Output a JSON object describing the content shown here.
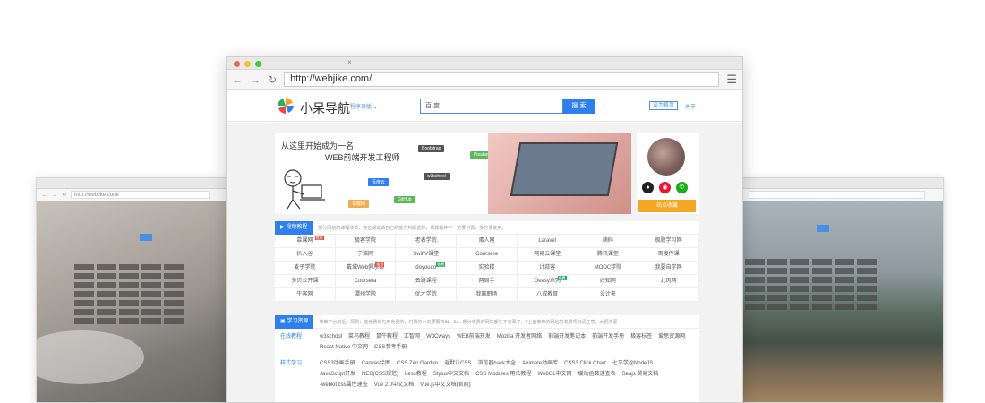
{
  "side_left": {
    "url": "http://webjike.com/"
  },
  "main": {
    "url": "http://webjike.com/",
    "brand": "小呆导航",
    "brand_sub": "程序员版 ⌄",
    "search_engine": "百 度",
    "search_button": "搜 索",
    "set_home": "设为首页",
    "about": "关于",
    "banner": {
      "line1": "从这里开始成为一名",
      "line2": "WEB前端开发工程师",
      "tags": [
        {
          "label": "Bootstrap",
          "color": "#555555"
        },
        {
          "label": "Pixabay",
          "color": "#5cb85c"
        },
        {
          "label": "w3school",
          "color": "#555555"
        },
        {
          "label": "百度云",
          "color": "#2f80ed"
        },
        {
          "label": "GitHub",
          "color": "#5cb85c"
        },
        {
          "label": "花瓣网",
          "color": "#f0ad4e"
        }
      ]
    },
    "follow_button": "站点收藏",
    "video_section": {
      "title": "视频教程",
      "desc": "部分网站的课程收费，各位朋友请自己的能力判断选择，看教程并不一定要付费，多方便使用。"
    },
    "video_rows": [
      [
        "慕课网",
        "极客学院",
        "老表学院",
        "蛋人网",
        "Laravel",
        "萌码",
        "极题学习网"
      ],
      [
        "扒入谷",
        "宁骆网",
        "SwiftV课堂",
        "Coursera",
        "网易云课堂",
        "腾讯课堂",
        "百度传课"
      ],
      [
        "麦子学院",
        "戴城Web俱乐部",
        "doyoudo",
        "实验楼",
        "计蒜客",
        "MOOC学院",
        "我要自学网"
      ],
      [
        "多贝公开课",
        "Coursera",
        "云路课程",
        "两周手",
        "Oeasy系列",
        "好知网",
        "北风网"
      ],
      [
        "牛客网",
        "潭州学院",
        "优才学院",
        "我赢职场",
        "八戒教育",
        "设计夹",
        ""
      ]
    ],
    "video_badges": [
      {
        "row": 0,
        "col": 0,
        "label": "推荐",
        "color": "#e74c3c"
      },
      {
        "row": 2,
        "col": 1,
        "label": "推荐",
        "color": "#e74c3c"
      },
      {
        "row": 2,
        "col": 2,
        "label": "免费",
        "color": "#27ae60"
      },
      {
        "row": 3,
        "col": 4,
        "label": "免费",
        "color": "#27ae60"
      }
    ],
    "learn_section": {
      "title": "学习资源",
      "desc": "推荐不分前后，原则：能免费就先用免费的，付费的一定要再掏出。So...部分收费的网站都先不收录了。//上面推荐的网站的收费项目请注意，大把资源"
    },
    "learn_rows": [
      {
        "label": "在线教程",
        "links": [
          "w3school",
          "菜鸟教程",
          "鼠牛教程",
          "汇智网",
          "W3Cways",
          "WEB前端开发",
          "Mozilla 开发者网络",
          "前端开发笔记本",
          "前端开发手册",
          "极客标签",
          "爱思资源网",
          "React Native 中文网",
          "CSS参考手册"
        ]
      },
      {
        "label": "样式学习",
        "links": [
          "CSS3动画手册",
          "Canvas绘图",
          "CSS Zen Garden",
          "返默认CSS",
          "浏览器hack大全",
          "Animate动画库",
          "CSS3 Click Chart",
          "七牙学@NodeJS",
          "JavaScript开发",
          "NEC(CSS规范)",
          "Less教程",
          "Stylus中文文档",
          "CSS Modules 用法教程",
          "WebGL中文网",
          "缓动函数速查表",
          "Seajs 莫易文档",
          "-webkit css属性速查",
          "Vue 2.0中文文档",
          "Vue.js中文文档(官网)"
        ]
      }
    ]
  },
  "colors": {
    "accent": "#2f80ed",
    "orange": "#f5a623",
    "page_bg": "#f2f2f2"
  }
}
